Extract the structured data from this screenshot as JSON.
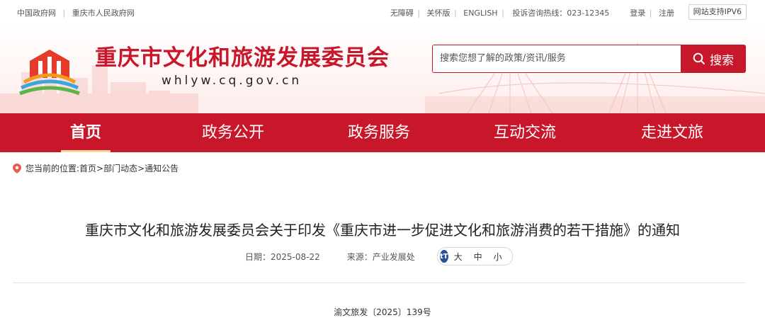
{
  "topbar": {
    "left_links": [
      "中国政府网",
      "重庆市人民政府网"
    ],
    "accessibility": "无障碍",
    "elder_mode": "关怀版",
    "english": "ENGLISH",
    "hotline": "投诉咨询热线：023-12345",
    "login": "登录",
    "register": "注册",
    "ipv6": "网站支持IPV6"
  },
  "header": {
    "title": "重庆市文化和旅游发展委员会",
    "domain": "whlyw.cq.gov.cn",
    "search_placeholder": "搜索您想了解的政策/资讯/服务",
    "search_button": "搜索"
  },
  "nav": {
    "items": [
      "首页",
      "政务公开",
      "政务服务",
      "互动交流",
      "走进文旅"
    ],
    "active": "首页"
  },
  "breadcrumb": {
    "text": "您当前的位置:首页>部门动态>通知公告"
  },
  "article": {
    "title": "重庆市文化和旅游发展委员会关于印发《重庆市进一步促进文化和旅游消费的若干措施》的通知",
    "date_label": "日期：2025-08-22",
    "source_label": "来源：产业发展处",
    "font_sizes": [
      "大",
      "中",
      "小"
    ],
    "doc_number": "渝文旅发〔2025〕139号"
  },
  "colors": {
    "brand_red": "#c8172a",
    "nav_underline": "#f5d7a0",
    "font_icon_blue": "#2b4f9c"
  }
}
